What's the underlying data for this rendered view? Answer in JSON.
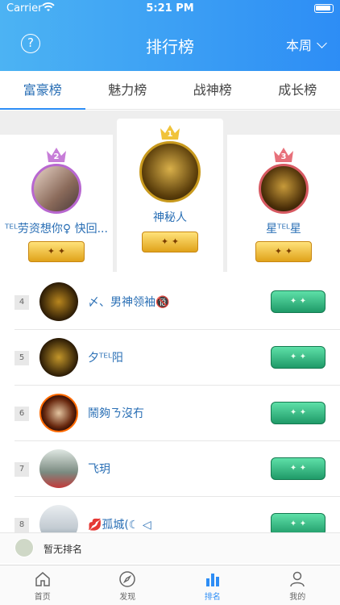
{
  "status": {
    "carrier": "Carrier",
    "time": "5:21 PM"
  },
  "nav": {
    "title": "排行榜",
    "help": "?",
    "period": "本周"
  },
  "tabs": [
    {
      "label": "富豪榜",
      "active": true
    },
    {
      "label": "魅力榜",
      "active": false
    },
    {
      "label": "战神榜",
      "active": false
    },
    {
      "label": "成长榜",
      "active": false
    }
  ],
  "podium": {
    "second": {
      "rank": "2",
      "name": "ᵀᴱᴸ劳资想你♀ 快回...",
      "crown_color": "#c77dd8"
    },
    "first": {
      "rank": "1",
      "name": "神秘人",
      "crown_color": "#f0c33a"
    },
    "third": {
      "rank": "3",
      "name": "星ᵀᴱᴸ星",
      "crown_color": "#e7707a"
    }
  },
  "list": [
    {
      "rank": "4",
      "name": "〆、男神领袖🔞"
    },
    {
      "rank": "5",
      "name": "夕ᵀᴱᴸ阳"
    },
    {
      "rank": "6",
      "name": "鬧夠ㄋ沒冇"
    },
    {
      "rank": "7",
      "name": "飞玥"
    },
    {
      "rank": "8",
      "name": "💋孤城(☾ ◁"
    }
  ],
  "my_rank": {
    "text": "暂无排名"
  },
  "tabbar": [
    {
      "label": "首页",
      "icon": "home-icon",
      "active": false
    },
    {
      "label": "发现",
      "icon": "compass-icon",
      "active": false
    },
    {
      "label": "排名",
      "icon": "bar-chart-icon",
      "active": true
    },
    {
      "label": "我的",
      "icon": "person-icon",
      "active": false
    }
  ],
  "colors": {
    "accent": "#2d8df5",
    "name_blue": "#2a6fb5"
  }
}
